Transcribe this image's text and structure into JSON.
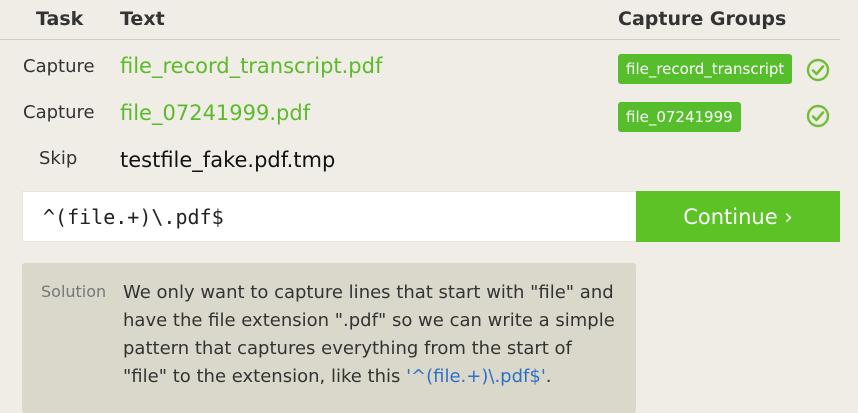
{
  "table": {
    "headers": {
      "task": "Task",
      "text": "Text",
      "groups": "Capture Groups"
    },
    "rows": [
      {
        "task": "Capture",
        "text": "file_record_transcript.pdf",
        "group": "file_record_transcript",
        "status": "check-icon"
      },
      {
        "task": "Capture",
        "text": "file_07241999.pdf",
        "group": "file_07241999",
        "status": "check-icon"
      },
      {
        "task": "Skip",
        "text": "testfile_fake.pdf.tmp"
      }
    ]
  },
  "regex_input": {
    "value": "^(file.+)\\.pdf$"
  },
  "continue_button": {
    "label": "Continue ›"
  },
  "solution": {
    "label": "Solution",
    "text": "We only want to capture lines that start with \"file\" and have the file extension \".pdf\" so we can write a simple pattern that captures everything from the start of \"file\" to the extension, like this ",
    "code": "'^(file.+)\\.pdf$'",
    "end": "."
  },
  "colors": {
    "accent": "#5cc225",
    "match_text": "#5dba2a",
    "badge": "#56bd2c",
    "link": "#2f70c7",
    "background": "#efede5",
    "panel": "#d9d8ca"
  }
}
